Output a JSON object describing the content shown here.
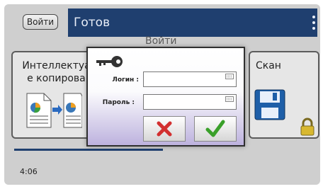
{
  "header": {
    "login_button": "Войти",
    "status": "Готов",
    "behind_title": "Войти"
  },
  "tiles": {
    "left_label": "Интеллектуал\nе копирован",
    "right_label": "Скан"
  },
  "clock": "4:06",
  "dialog": {
    "login_label": "Логин :",
    "password_label": "Пароль :",
    "login_value": "",
    "password_value": ""
  },
  "icons": {
    "key": "key-icon",
    "keyboard": "keyboard-icon",
    "cancel": "cross-icon",
    "ok": "checkmark-icon",
    "save": "floppy-disk-icon",
    "lock": "padlock-icon"
  }
}
